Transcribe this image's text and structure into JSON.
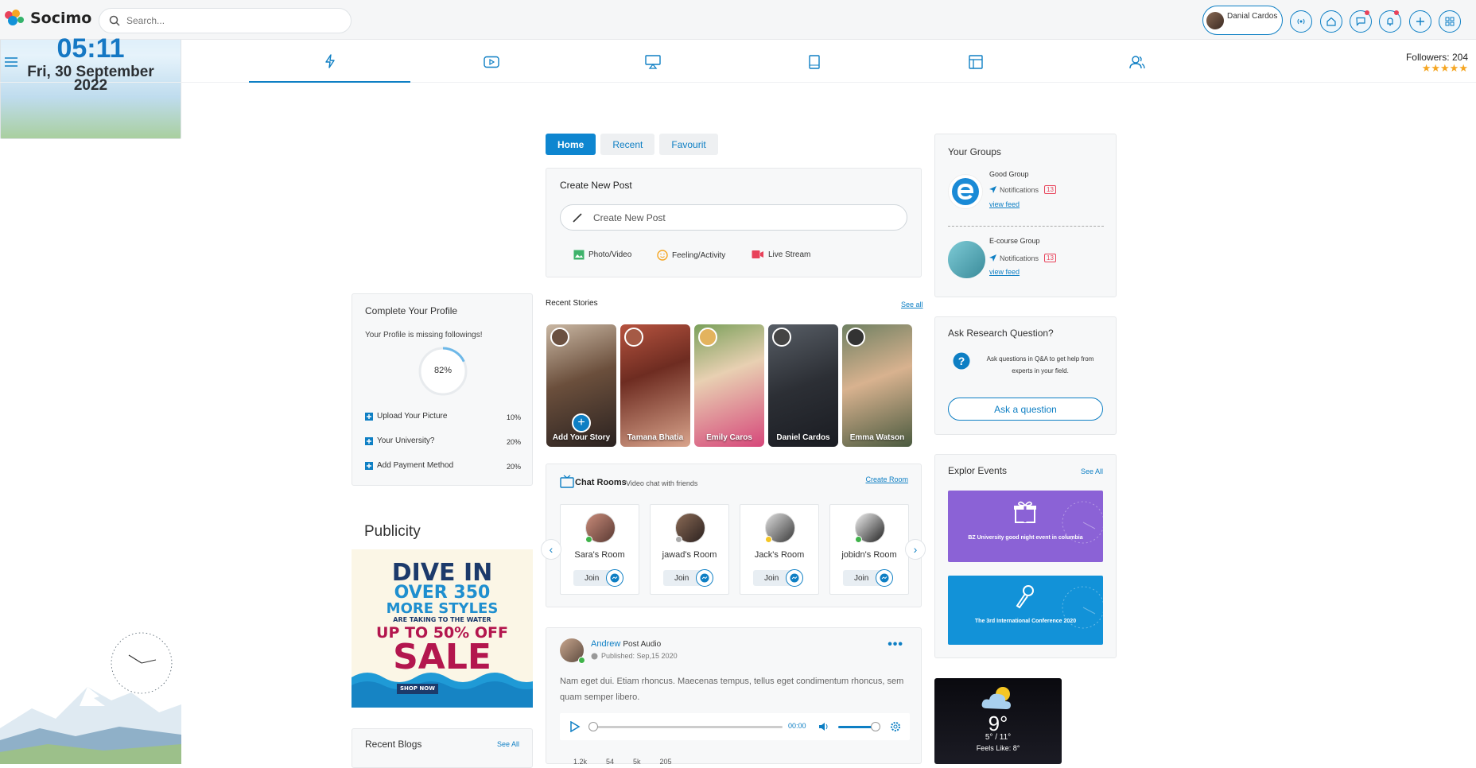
{
  "app": {
    "name": "Socimo"
  },
  "search": {
    "placeholder": "Search..."
  },
  "user": {
    "name": "Danial Cardos"
  },
  "nav": {
    "followers": "Followers: 204",
    "stars": "★★★★★"
  },
  "clock": {
    "time": "05:11",
    "date_line1": "Fri, 30 September",
    "date_line2": "2022"
  },
  "profile": {
    "title": "Complete Your Profile",
    "subtitle": "Your Profile is missing followings!",
    "percent": "82%",
    "percent_value": 82,
    "items": [
      {
        "label": "Upload Your Picture",
        "value": "10%"
      },
      {
        "label": "Your University?",
        "value": "20%"
      },
      {
        "label": "Add Payment Method",
        "value": "20%"
      }
    ]
  },
  "publicity": {
    "title": "Publicity",
    "ad": {
      "line1": "DIVE IN",
      "line2": "OVER 350",
      "line3": "MORE STYLES",
      "line4": "ARE TAKING TO THE WATER",
      "line5": "UP TO 50% OFF",
      "line6": "SALE",
      "cta": "SHOP NOW"
    }
  },
  "blogs": {
    "title": "Recent Blogs",
    "see_all": "See All"
  },
  "feed_tabs": [
    "Home",
    "Recent",
    "Favourit"
  ],
  "create_post": {
    "title": "Create New Post",
    "placeholder": "Create New Post",
    "actions": [
      "Photo/Video",
      "Feeling/Activity",
      "Live Stream"
    ]
  },
  "stories": {
    "title": "Recent Stories",
    "see_all": "See all",
    "items": [
      "Add Your Story",
      "Tamana Bhatia",
      "Emily Caros",
      "Daniel Cardos",
      "Emma Watson"
    ]
  },
  "chat_rooms": {
    "title": "Chat Rooms",
    "subtitle": "Video chat with friends",
    "create": "Create Room",
    "join_label": "Join",
    "rooms": [
      "Sara's Room",
      "jawad's Room",
      "Jack's Room",
      "jobidn's Room"
    ]
  },
  "post": {
    "author": "Andrew",
    "type": "Post Audio",
    "published": "Published: Sep,15 2020",
    "body": "Nam eget dui. Etiam rhoncus. Maecenas tempus, tellus eget condimentum rhoncus, sem quam semper libero.",
    "audio_time": "00:00",
    "stats": [
      "1.2k",
      "54",
      "5k",
      "205"
    ]
  },
  "groups": {
    "title": "Your Groups",
    "notif_label": "Notifications",
    "view_feed": "view feed",
    "items": [
      {
        "name": "Good Group",
        "count": "13"
      },
      {
        "name": "E-course Group",
        "count": "13"
      }
    ]
  },
  "ask": {
    "title": "Ask Research Question?",
    "text": "Ask questions in Q&A to get help from experts in your field.",
    "button": "Ask a question"
  },
  "events": {
    "title": "Explor Events",
    "see_all": "See All",
    "items": [
      {
        "label": "BZ University good night event in columbia",
        "color": "#8b62d6"
      },
      {
        "label": "The 3rd International Conference 2020",
        "color": "#1292d8"
      }
    ]
  },
  "weather": {
    "temp": "9°",
    "range": "5° / 11°",
    "feels": "Feels Like: 8°"
  }
}
